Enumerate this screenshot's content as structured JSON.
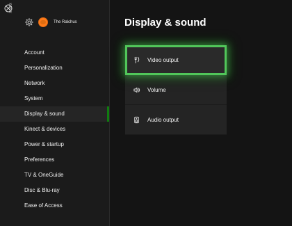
{
  "brand": {
    "logo_text": "XBOX"
  },
  "profile": {
    "gamertag": "The Ralchus"
  },
  "sidebar": {
    "items": [
      {
        "label": "Account"
      },
      {
        "label": "Personalization"
      },
      {
        "label": "Network"
      },
      {
        "label": "System"
      },
      {
        "label": "Display & sound",
        "selected": true
      },
      {
        "label": "Kinect & devices"
      },
      {
        "label": "Power & startup"
      },
      {
        "label": "Preferences"
      },
      {
        "label": "TV & OneGuide"
      },
      {
        "label": "Disc & Blu-ray"
      },
      {
        "label": "Ease of Access"
      }
    ]
  },
  "main": {
    "title": "Display & sound",
    "items": [
      {
        "label": "Video output",
        "icon": "video-output-icon",
        "focused": true
      },
      {
        "label": "Volume",
        "icon": "volume-icon"
      },
      {
        "label": "Audio output",
        "icon": "audio-output-icon"
      }
    ]
  },
  "colors": {
    "accent": "#107c10",
    "focus": "#51c65a",
    "profile": "#ff7a18",
    "background": "#141414",
    "sidebar": "#1b1b1b",
    "tile": "#242424"
  }
}
